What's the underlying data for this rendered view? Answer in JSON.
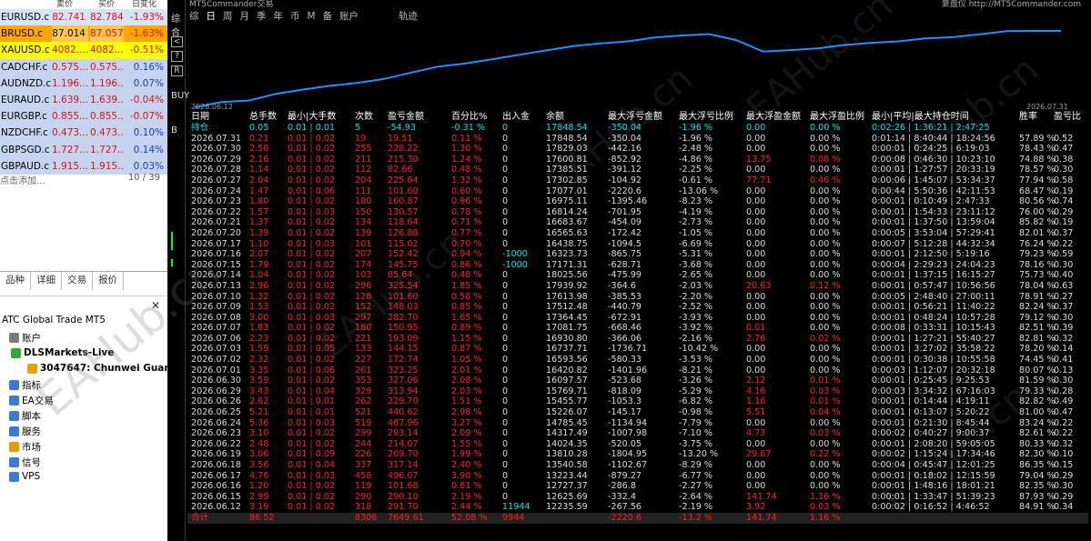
{
  "market_watch": {
    "header": {
      "bid": "卖价",
      "ask": "买价",
      "change": "日变化"
    },
    "rows": [
      {
        "symbol": "EURUSD.c",
        "bid": "82.741",
        "ask": "82.784",
        "change": "-1.93%",
        "cls": "hl-red"
      },
      {
        "symbol": "BRUSD.c",
        "bid": "87.014",
        "ask": "87.057",
        "change": "-1.63%",
        "cls": "orange"
      },
      {
        "symbol": "XAUUSD.c",
        "bid": "4082....",
        "ask": "4082....",
        "change": "-0.51%",
        "cls": "yel"
      },
      {
        "symbol": "CADCHF.c",
        "bid": "0.575...",
        "ask": "0.575...",
        "change": "0.16%",
        "cls": "blue"
      },
      {
        "symbol": "AUDNZD.c",
        "bid": "1.196...",
        "ask": "1.196...",
        "change": "0.07%",
        "cls": "blue"
      },
      {
        "symbol": "EURAUD.c",
        "bid": "1.639...",
        "ask": "1.639...",
        "change": "-0.04%",
        "cls": "blue"
      },
      {
        "symbol": "EURGBP.c",
        "bid": "0.855...",
        "ask": "0.855...",
        "change": "-0.07%",
        "cls": "blue"
      },
      {
        "symbol": "NZDCHF.c",
        "bid": "0.473...",
        "ask": "0.473...",
        "change": "0.10%",
        "cls": "blue"
      },
      {
        "symbol": "GBPSGD.c",
        "bid": "1.727...",
        "ask": "1.727...",
        "change": "0.14%",
        "cls": "blue"
      },
      {
        "symbol": "GBPAUD.c",
        "bid": "1.915...",
        "ask": "1.915...",
        "change": "0.03%",
        "cls": "blue"
      }
    ],
    "add_label": "点击添加...",
    "count": "10 / 39"
  },
  "bottom_tabs": [
    "品种",
    "详细",
    "交易",
    "报价"
  ],
  "navigator": {
    "root": "ATC Global Trade MT5",
    "items": [
      {
        "label": "账户",
        "color": "#7a7a7a"
      },
      {
        "label": "DLSMarkets-Live",
        "color": "#2eaa2e"
      },
      {
        "label": "3047647: Chunwei Guan",
        "color": "#e8a300"
      },
      {
        "label": "指标",
        "color": "#3a7bd5"
      },
      {
        "label": "EA交易",
        "color": "#3a7bd5"
      },
      {
        "label": "脚本",
        "color": "#3a7bd5"
      },
      {
        "label": "服务",
        "color": "#3a7bd5"
      },
      {
        "label": "市场",
        "color": "#e89a00"
      },
      {
        "label": "信号",
        "color": "#3a7bd5"
      },
      {
        "label": "VPS",
        "color": "#3a7bd5"
      }
    ]
  },
  "chart": {
    "title_left": "MT5Commander交易",
    "title_right": "复盘仪 http://MT5Commander.com",
    "period_tabs": [
      "综",
      "日",
      "周",
      "月",
      "季",
      "年",
      "币",
      "M",
      "备",
      "账户"
    ],
    "active_tab": "日",
    "track_label": "轨迹",
    "start_date": "2026.06.12",
    "end_date": "2026.07.31",
    "curve_color": "#1e90ff",
    "curve_values": [
      12235,
      12625,
      12727,
      13223,
      13540,
      13810,
      14024,
      14317,
      14785,
      15226,
      15455,
      15769,
      16097,
      16420,
      16737,
      16930,
      17081,
      17364,
      17512,
      17613,
      17171,
      16323,
      16438,
      16565,
      16814,
      16975,
      17077,
      17302,
      17385,
      17600,
      17829,
      17848,
      17848
    ]
  },
  "left_tool": {
    "buttons": [
      "<",
      "?",
      "Ri"
    ],
    "labels": [
      "综合",
      "我的",
      "账户",
      "BUY",
      "B"
    ]
  },
  "stats": {
    "headers": [
      "日期",
      "总手数",
      "最小|大手数",
      "次数",
      "盈亏金额",
      "百分比%",
      "出入金",
      "余额",
      "最大浮亏金额",
      "最大浮亏比例",
      "最大浮盈金额",
      "最大浮盈比例",
      "最小|平均|最大持仓时间",
      "胜率",
      "盈亏比"
    ],
    "holding": [
      "持仓",
      "0.05",
      "0.01 | 0.01",
      "5",
      "-54.93",
      "-0.31 %",
      "0",
      "17848.54",
      "-350.04",
      "-1.96 %",
      "0.00",
      "0.00 %",
      "0:02:26 | 1:36:21 | 2:47:25",
      "",
      ""
    ],
    "rows": [
      [
        "2026.07.31",
        "0.21",
        "0.01 | 0.02",
        "19",
        "19.51",
        "0.11 %",
        "0",
        "17848.54",
        "-350.04",
        "-1.96 %",
        "0.00",
        "0.00 %",
        "0:01:14 | 8:40:44 | 18:24:56",
        "57.89 %",
        "0.52"
      ],
      [
        "2026.07.30",
        "2.58",
        "0.01 | 0.02",
        "255",
        "228.22",
        "1.30 %",
        "0",
        "17829.03",
        "-442.16",
        "-2.48 %",
        "0.00",
        "0.00 %",
        "0:00:01 | 0:24:25 | 6:19:03",
        "78.43 %",
        "0.47"
      ],
      [
        "2026.07.29",
        "2.16",
        "0.01 | 0.02",
        "211",
        "215.30",
        "1.24 %",
        "0",
        "17600.81",
        "-852.92",
        "-4.86 %",
        "13.75",
        "0.08 %",
        "0:00:08 | 0:46:30 | 10:23:10",
        "74.88 %",
        "0.38"
      ],
      [
        "2026.07.28",
        "1.14",
        "0.01 | 0.02",
        "112",
        "82.66",
        "0.48 %",
        "0",
        "17385.51",
        "-391.12",
        "-2.25 %",
        "0.00",
        "0.00 %",
        "0:00:01 | 1:27:57 | 20:33:19",
        "78.57 %",
        "0.30"
      ],
      [
        "2026.07.27",
        "2.04",
        "0.01 | 0.02",
        "204",
        "225.64",
        "1.32 %",
        "0",
        "17302.85",
        "-104.92",
        "-0.61 %",
        "77.71",
        "0.46 %",
        "0:00:06 | 1:45:07 | 53:34:37",
        "77.94 %",
        "0.58"
      ],
      [
        "2026.07.24",
        "1.47",
        "0.01 | 0.06",
        "111",
        "101.60",
        "0.60 %",
        "0",
        "17077.01",
        "-2220.6",
        "-13.06 %",
        "0.00",
        "0.00 %",
        "0:00:44 | 5:50:36 | 42:11:53",
        "68.47 %",
        "0.19"
      ],
      [
        "2026.07.23",
        "1.80",
        "0.01 | 0.02",
        "180",
        "160.87",
        "0.96 %",
        "0",
        "16975.11",
        "-1395.46",
        "-8.23 %",
        "0.00",
        "0.00 %",
        "0:00:01 | 0:10:49 | 2:47:33",
        "80.56 %",
        "0.74"
      ],
      [
        "2026.07.22",
        "1.57",
        "0.01 | 0.03",
        "150",
        "130.57",
        "0.78 %",
        "0",
        "16814.24",
        "-701.95",
        "-4.19 %",
        "0.00",
        "0.00 %",
        "0:00:01 | 1:54:33 | 23:11:12",
        "76.00 %",
        "0.29"
      ],
      [
        "2026.07.21",
        "1.37",
        "0.01 | 0.02",
        "134",
        "118.64",
        "0.71 %",
        "0",
        "16683.67",
        "-454.09",
        "-2.73 %",
        "0.00",
        "0.00 %",
        "0:00:01 | 1:37:50 | 13:59:04",
        "85.82 %",
        "0.19"
      ],
      [
        "2026.07.20",
        "1.39",
        "0.01 | 0.02",
        "139",
        "126.88",
        "0.77 %",
        "0",
        "16565.63",
        "-172.42",
        "-1.05 %",
        "0.00",
        "0.00 %",
        "0:00:05 | 3:53:04 | 57:29:41",
        "82.01 %",
        "0.37"
      ],
      [
        "2026.07.17",
        "1.10",
        "0.01 | 0.03",
        "101",
        "115.02",
        "0.70 %",
        "0",
        "16438.75",
        "-1094.5",
        "-6.69 %",
        "0.00",
        "0.00 %",
        "0:00:07 | 5:12:28 | 44:32:34",
        "76.24 %",
        "0.22"
      ],
      [
        "2026.07.16",
        "2.07",
        "0.01 | 0.02",
        "207",
        "152.42",
        "0.94 %",
        "-1000",
        "16323.73",
        "-865.75",
        "-5.31 %",
        "0.00",
        "0.00 %",
        "0:00:01 | 2:12:50 | 5:19:16",
        "79.23 %",
        "0.59"
      ],
      [
        "2026.07.15",
        "1.79",
        "0.01 | 0.02",
        "174",
        "145.75",
        "0.86 %",
        "-1000",
        "17171.31",
        "-628.71",
        "-3.68 %",
        "0.00",
        "0.00 %",
        "0:00:04 | 2:29:23 | 24:04:23",
        "78.16 %",
        "0.30"
      ],
      [
        "2026.07.14",
        "1.04",
        "0.01 | 0.02",
        "103",
        "85.64",
        "0.48 %",
        "0",
        "18025.56",
        "-475.99",
        "-2.65 %",
        "0.00",
        "0.00 %",
        "0:00:01 | 1:37:15 | 16:15:27",
        "75.73 %",
        "0.40"
      ],
      [
        "2026.07.13",
        "2.96",
        "0.01 | 0.02",
        "296",
        "325.54",
        "1.85 %",
        "0",
        "17939.92",
        "-364.6",
        "-2.03 %",
        "20.63",
        "0.12 %",
        "0:00:01 | 0:57:47 | 10:56:56",
        "78.04 %",
        "0.63"
      ],
      [
        "2026.07.10",
        "1.32",
        "0.01 | 0.02",
        "128",
        "101.60",
        "0.58 %",
        "0",
        "17613.98",
        "-385.53",
        "-2.20 %",
        "0.00",
        "0.00 %",
        "0:00:05 | 2:48:40 | 27:00:11",
        "78.91 %",
        "0.27"
      ],
      [
        "2026.07.09",
        "1.53",
        "0.01 | 0.02",
        "152",
        "148.03",
        "0.85 %",
        "0",
        "17512.48",
        "-440.79",
        "-2.52 %",
        "0.00",
        "0.00 %",
        "0:00:01 | 0:56:21 | 11:40:22",
        "82.24 %",
        "0.37"
      ],
      [
        "2026.07.08",
        "3.00",
        "0.01 | 0.03",
        "297",
        "282.70",
        "1.65 %",
        "0",
        "17364.45",
        "-672.91",
        "-3.93 %",
        "0.00",
        "0.00 %",
        "0:00:01 | 0:48:24 | 10:57:28",
        "79.12 %",
        "0.30"
      ],
      [
        "2026.07.07",
        "1.83",
        "0.01 | 0.02",
        "180",
        "150.95",
        "0.89 %",
        "0",
        "17081.75",
        "-668.46",
        "-3.92 %",
        "0.01",
        "0.00 %",
        "0:00:08 | 0:33:31 | 10:15:43",
        "82.51 %",
        "0.39"
      ],
      [
        "2026.07.06",
        "2.23",
        "0.01 | 0.02",
        "221",
        "193.09",
        "1.15 %",
        "0",
        "16930.80",
        "-366.06",
        "-2.16 %",
        "2.76",
        "0.02 %",
        "0:00:01 | 1:27:21 | 55:40:27",
        "82.81 %",
        "0.32"
      ],
      [
        "2026.07.03",
        "1.59",
        "0.01 | 0.05",
        "133",
        "144.15",
        "0.87 %",
        "0",
        "16737.71",
        "-1736.71",
        "-10.42 %",
        "0.00",
        "0.00 %",
        "0:00:01 | 3:27:02 | 35:58:22",
        "78.20 %",
        "0.14"
      ],
      [
        "2026.07.02",
        "2.32",
        "0.01 | 0.02",
        "227",
        "172.74",
        "1.05 %",
        "0",
        "16593.56",
        "-580.33",
        "-3.53 %",
        "0.00",
        "0.00 %",
        "0:00:01 | 0:30:38 | 10:55:58",
        "74.45 %",
        "0.41"
      ],
      [
        "2026.07.01",
        "3.35",
        "0.01 | 0.06",
        "261",
        "323.25",
        "2.01 %",
        "0",
        "16420.82",
        "-1401.96",
        "-8.21 %",
        "0.00",
        "0.00 %",
        "0:00:03 | 1:12:07 | 20:32:18",
        "80.07 %",
        "0.13"
      ],
      [
        "2026.06.30",
        "3.59",
        "0.01 | 0.02",
        "353",
        "327.06",
        "2.08 %",
        "0",
        "16097.57",
        "-523.68",
        "-3.26 %",
        "2.12",
        "0.01 %",
        "0:00:01 | 0:25:45 | 9:25:53",
        "81.59 %",
        "0.30"
      ],
      [
        "2026.06.29",
        "3.43",
        "0.01 | 0.04",
        "329",
        "313.94",
        "2.03 %",
        "0",
        "15769.71",
        "-818.09",
        "-5.29 %",
        "4.16",
        "0.03 %",
        "0:00:03 | 3:34:32 | 67:16:03",
        "79.33 %",
        "0.28"
      ],
      [
        "2026.06.26",
        "2.62",
        "0.01 | 0.01",
        "262",
        "229.70",
        "1.51 %",
        "0",
        "15455.77",
        "-1053.3",
        "-6.82 %",
        "1.16",
        "0.01 %",
        "0:00:01 | 0:14:44 | 4:19:11",
        "82.82 %",
        "0.49"
      ],
      [
        "2026.06.25",
        "5.21",
        "0.01 | 0.01",
        "521",
        "440.62",
        "2.98 %",
        "0",
        "15226.07",
        "-145.17",
        "-0.98 %",
        "5.51",
        "0.04 %",
        "0:00:01 | 0:13:07 | 5:20:22",
        "81.00 %",
        "0.47"
      ],
      [
        "2026.06.24",
        "5.36",
        "0.01 | 0.03",
        "519",
        "467.96",
        "3.27 %",
        "0",
        "14785.45",
        "-1134.94",
        "-7.79 %",
        "0.00",
        "0.00 %",
        "0:00:01 | 0:21:30 | 8:45:44",
        "83.24 %",
        "0.22"
      ],
      [
        "2026.06.23",
        "3.10",
        "0.01 | 0.02",
        "299",
        "293.14",
        "2.09 %",
        "0",
        "14317.49",
        "-1007.98",
        "-7.10 %",
        "4.73",
        "0.03 %",
        "0:00:02 | 0:40:27 | 9:00:37",
        "82.61 %",
        "0.22"
      ],
      [
        "2026.06.22",
        "2.48",
        "0.01 | 0.02",
        "244",
        "214.07",
        "1.55 %",
        "0",
        "14024.35",
        "-520.05",
        "-3.75 %",
        "0.00",
        "0.00 %",
        "0:00:01 | 2:08:20 | 59:05:05",
        "80.33 %",
        "0.32"
      ],
      [
        "2026.06.19",
        "3.06",
        "0.01 | 0.09",
        "226",
        "269.70",
        "1.99 %",
        "0",
        "13810.28",
        "-1804.95",
        "-13.20 %",
        "29.67",
        "0.22 %",
        "0:00:02 | 1:15:24 | 17:34:46",
        "82.30 %",
        "0.10"
      ],
      [
        "2026.06.18",
        "3.56",
        "0.01 | 0.04",
        "337",
        "317.14",
        "2.40 %",
        "0",
        "13540.58",
        "-1102.67",
        "-8.29 %",
        "0.00",
        "0.00 %",
        "0:00:04 | 0:45:47 | 12:01:25",
        "86.35 %",
        "0.15"
      ],
      [
        "2026.06.17",
        "4.76",
        "0.01 | 0.03",
        "458",
        "496.07",
        "3.90 %",
        "0",
        "13223.44",
        "-879.27",
        "-6.77 %",
        "0.00",
        "0.00 %",
        "0:00:01 | 0:18:02 | 12:15:59",
        "79.04 %",
        "0.29"
      ],
      [
        "2026.06.16",
        "1.20",
        "0.01 | 0.02",
        "119",
        "101.68",
        "0.81 %",
        "0",
        "12727.37",
        "-286.8",
        "-2.27 %",
        "0.00",
        "0.00 %",
        "0:00:01 | 1:48:16 | 18:01:21",
        "82.35 %",
        "0.30"
      ],
      [
        "2026.06.15",
        "2.99",
        "0.01 | 0.02",
        "290",
        "290.10",
        "2.19 %",
        "0",
        "12625.69",
        "-332.4",
        "-2.64 %",
        "141.74",
        "1.16 %",
        "0:00:01 | 1:33:47 | 51:39:23",
        "87.93 %",
        "0.29"
      ],
      [
        "2026.06.12",
        "3.19",
        "0.01 | 0.02",
        "318",
        "291.70",
        "2.44 %",
        "11944",
        "12235.59",
        "-267.56",
        "-2.19 %",
        "3.92",
        "0.03 %",
        "0:00:02 | 0:16:52 | 4:46:52",
        "84.91 %",
        "0.34"
      ]
    ],
    "total": [
      "合计",
      "86.52",
      "",
      "8306",
      "7649.61",
      "52.08 %",
      "9944",
      "",
      "-2220.6",
      "-13.2 %",
      "141.74",
      "1.16 %",
      "",
      "",
      ""
    ]
  },
  "watermark": "EAHub.cn"
}
